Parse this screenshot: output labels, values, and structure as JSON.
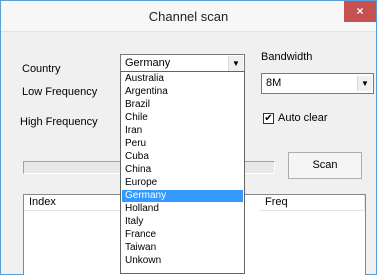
{
  "window": {
    "title": "Channel scan",
    "close_glyph": "×"
  },
  "labels": {
    "country": "Country",
    "low_frequency": "Low Frequency",
    "high_frequency": "High Frequency",
    "bandwidth": "Bandwidth"
  },
  "country_select": {
    "value": "Germany"
  },
  "bandwidth_select": {
    "value": "8M"
  },
  "auto_clear": {
    "label": "Auto clear",
    "checked": true,
    "check_glyph": "✔"
  },
  "scan_button": {
    "label": "Scan"
  },
  "results_table": {
    "columns": [
      "Index",
      "Freq"
    ]
  },
  "country_dropdown": {
    "options": [
      "Australia",
      "Argentina",
      "Brazil",
      "Chile",
      "Iran",
      "Peru",
      "Cuba",
      "China",
      "Europe",
      "Germany",
      "Holland",
      "Italy",
      "France",
      "Taiwan",
      "Unkown"
    ],
    "selected_index": 9
  },
  "icons": {
    "dropdown_arrow": "▼"
  },
  "colors": {
    "selection": "#3399ff",
    "close_button": "#c75050"
  }
}
